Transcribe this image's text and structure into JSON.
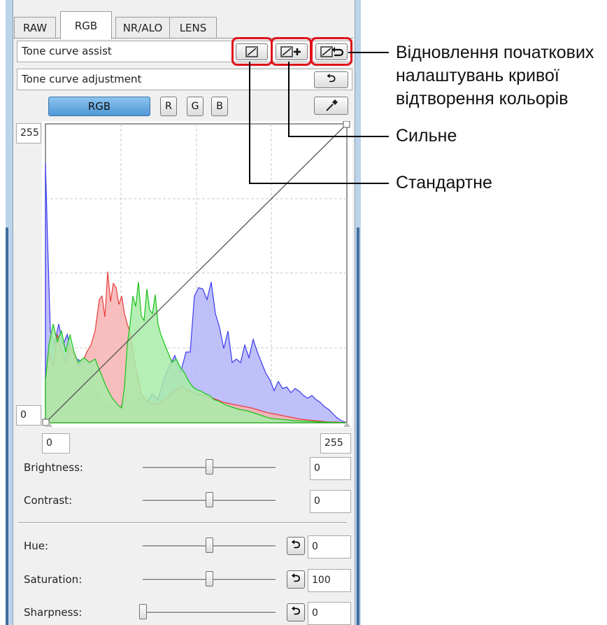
{
  "tabs": [
    "RAW",
    "RGB",
    "NR/ALO",
    "LENS"
  ],
  "active_tab": "RGB",
  "tone_curve_assist": {
    "label": "Tone curve assist",
    "buttons": [
      "standard-assist",
      "strong-assist",
      "reset-assist"
    ]
  },
  "tone_curve_adjustment": {
    "label": "Tone curve adjustment"
  },
  "channels": {
    "rgb": "RGB",
    "r": "R",
    "g": "G",
    "b": "B"
  },
  "curve": {
    "y_top": "255",
    "y_bottom": "0",
    "input_value": "0",
    "output_value": "255"
  },
  "sliders": [
    {
      "label": "Brightness:",
      "value": "0",
      "position": 0.5,
      "reset": false
    },
    {
      "label": "Contrast:",
      "value": "0",
      "position": 0.5,
      "reset": false
    },
    {
      "label": "Hue:",
      "value": "0",
      "position": 0.5,
      "reset": true
    },
    {
      "label": "Saturation:",
      "value": "100",
      "position": 0.5,
      "reset": true
    },
    {
      "label": "Sharpness:",
      "value": "0",
      "position": 0.0,
      "reset": true
    }
  ],
  "callouts": {
    "reset": [
      "Відновлення початкових",
      "налаштувань кривої",
      "відтворення кольорів"
    ],
    "strong": "Сильне",
    "standard": "Стандартне"
  },
  "colors": {
    "highlight": "#e0111b",
    "rgb_button": "#5aa3de",
    "histogram_red": "#e83c3c",
    "histogram_green": "#19c219",
    "histogram_blue": "#3a3af0",
    "frame_blue": "#3f6f9e"
  }
}
